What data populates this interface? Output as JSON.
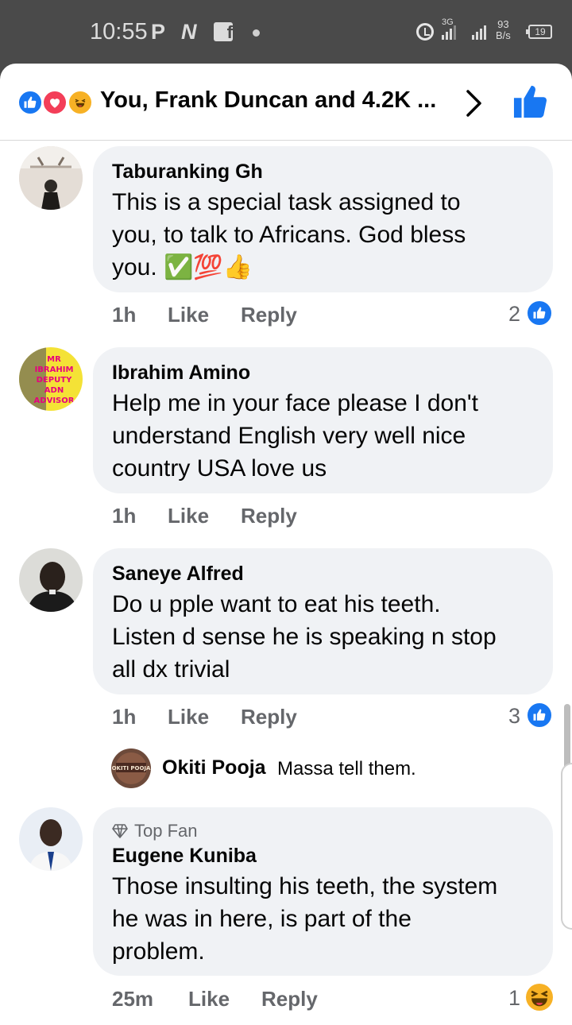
{
  "status_bar": {
    "time": "10:55",
    "network_label": "3G",
    "speed_value": "93",
    "speed_unit": "B/s",
    "battery": "19"
  },
  "header": {
    "reactions_text": "You, Frank Duncan and 4.2K ...",
    "reaction_icons": [
      "like-icon",
      "love-icon",
      "haha-icon"
    ]
  },
  "comments": [
    {
      "name": "Taburanking Gh",
      "lines": [
        "This is a special task assigned to",
        "you, to talk to Africans. God bless",
        "you. ✅💯👍"
      ],
      "time": "1h",
      "like_label": "Like",
      "reply_label": "Reply",
      "reaction_count": "2",
      "reaction": "like-icon"
    },
    {
      "name": "Ibrahim Amino",
      "lines": [
        "Help me in your face please I don't",
        "understand English very well nice",
        "country USA love us"
      ],
      "time": "1h",
      "like_label": "Like",
      "reply_label": "Reply",
      "avatar_text": "MR IBRAHIM DEPUTY ADN ADVISOR"
    },
    {
      "name": "Saneye Alfred",
      "lines": [
        "Do u pple want to eat his teeth.",
        "Listen d sense he is speaking n stop",
        "all dx trivial"
      ],
      "time": "1h",
      "like_label": "Like",
      "reply_label": "Reply",
      "reaction_count": "3",
      "reaction": "like-icon",
      "reply": {
        "name": "Okiti Pooja",
        "text": "Massa tell them.",
        "avatar_text": "OKITI POOJA"
      }
    },
    {
      "badge": "Top Fan",
      "name": "Eugene Kuniba",
      "lines": [
        "Those insulting his teeth, the system",
        "he was in here, is part of the",
        "problem."
      ],
      "time": "25m",
      "like_label": "Like",
      "reply_label": "Reply",
      "reaction_count": "1",
      "reaction": "haha-icon"
    }
  ],
  "colors": {
    "facebook_blue": "#1877f2",
    "love_red": "#f33e58",
    "haha_yellow": "#f7b125",
    "bubble_bg": "#f0f2f5",
    "meta_gray": "#65676b"
  }
}
